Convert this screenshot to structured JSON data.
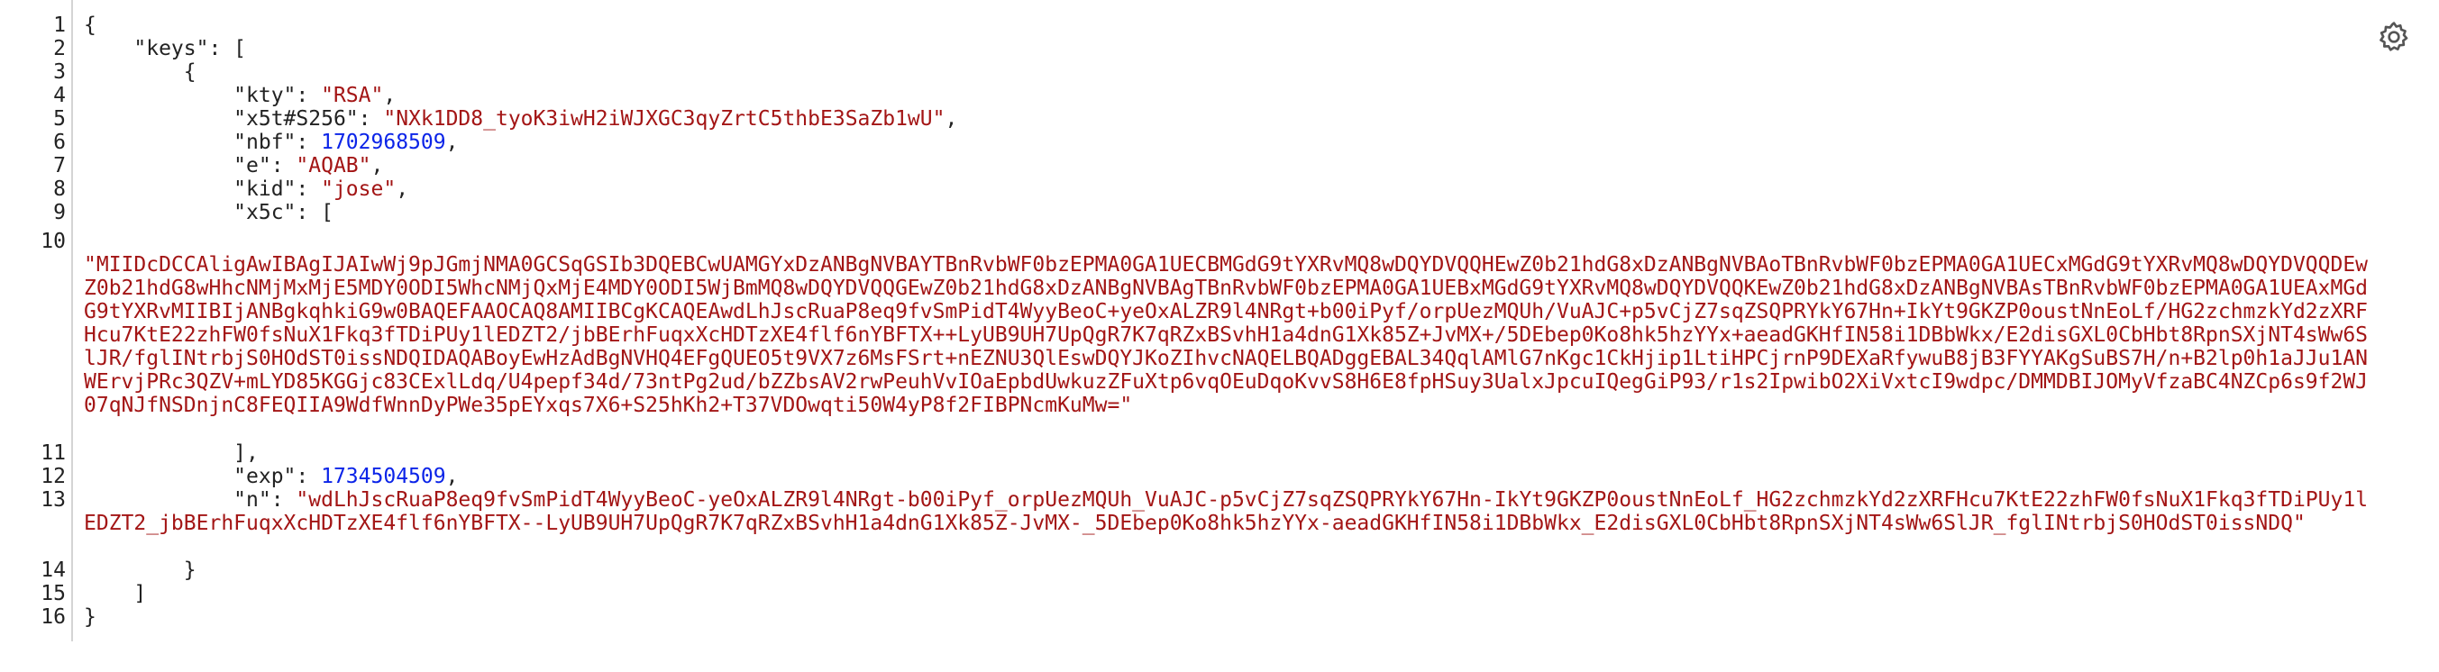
{
  "editor": {
    "line_numbers": [
      "1",
      "2",
      "3",
      "4",
      "5",
      "6",
      "7",
      "8",
      "9",
      "10",
      "11",
      "12",
      "13",
      "14",
      "15",
      "16"
    ],
    "lines": {
      "l1": {
        "p1": "{"
      },
      "l2": {
        "p1": "    \"keys\": ["
      },
      "l3": {
        "p1": "        {"
      },
      "l4": {
        "k": "            \"kty\": ",
        "v": "\"RSA\"",
        "t": ","
      },
      "l5": {
        "k": "            \"x5t#S256\": ",
        "v": "\"NXk1DD8_tyoK3iwH2iWJXGC3qyZrtC5thbE3SaZb1wU\"",
        "t": ","
      },
      "l6": {
        "k": "            \"nbf\": ",
        "v": "1702968509",
        "t": ","
      },
      "l7": {
        "k": "            \"e\": ",
        "v": "\"AQAB\"",
        "t": ","
      },
      "l8": {
        "k": "            \"kid\": ",
        "v": "\"jose\"",
        "t": ","
      },
      "l9": {
        "p1": "            \"x5c\": ["
      },
      "l10": {
        "v": "\"MIIDcDCCAligAwIBAgIJAIwWj9pJGmjNMA0GCSqGSIb3DQEBCwUAMGYxDzANBgNVBAYTBnRvbWF0bzEPMA0GA1UECBMGdG9tYXRvMQ8wDQYDVQQHEwZ0b21hdG8xDzANBgNVBAoTBnRvbWF0bzEPMA0GA1UECxMGdG9tYXRvMQ8wDQYDVQQDEwZ0b21hdG8wHhcNMjMxMjE5MDY0ODI5WhcNMjQxMjE4MDY0ODI5WjBmMQ8wDQYDVQQGEwZ0b21hdG8xDzANBgNVBAgTBnRvbWF0bzEPMA0GA1UEBxMGdG9tYXRvMQ8wDQYDVQQKEwZ0b21hdG8xDzANBgNVBAsTBnRvbWF0bzEPMA0GA1UEAxMGdG9tYXRvMIIBIjANBgkqhkiG9w0BAQEFAAOCAQ8AMIIBCgKCAQEAwdLhJscRuaP8eq9fvSmPidT4WyyBeoC+yeOxALZR9l4NRgt+b00iPyf/orpUezMQUh/VuAJC+p5vCjZ7sqZSQPRYkY67Hn+IkYt9GKZP0oustNnEoLf/HG2zchmzkYd2zXRFHcu7KtE22zhFW0fsNuX1Fkq3fTDiPUy1lEDZT2/jbBErhFuqxXcHDTzXE4flf6nYBFTX++LyUB9UH7UpQgR7K7qRZxBSvhH1a4dnG1Xk85Z+JvMX+/5DEbep0Ko8hk5hzYYx+aeadGKHfIN58i1DBbWkx/E2disGXL0CbHbt8RpnSXjNT4sWw6SlJR/fglINtrbjS0HOdST0issNDQIDAQABoyEwHzAdBgNVHQ4EFgQUEO5t9VX7z6MsFSrt+nEZNU3QlEswDQYJKoZIhvcNAQELBQADggEBAL34QqlAMlG7nKgc1CkHjip1LtiHPCjrnP9DEXaRfywuB8jB3FYYAKgSuBS7H/n+B2lp0h1aJJu1ANWErvjPRc3QZV+mLYD85KGGjc83CExlLdq/U4pepf34d/73ntPg2ud/bZZbsAV2rwPeuhVvIOaEpbdUwkuzZFuXtp6vqOEuDqoKvvS8H6E8fpHSuy3UalxJpcuIQegGiP93/r1s2IpwibO2XiVxtcI9wdpc/DMMDBIJOMyVfzaBC4NZCp6s9f2WJ07qNJfNSDnjnC8FEQIIA9WdfWnnDyPWe35pEYxqs7X6+S25hKh2+T37VDOwqti50W4yP8f2FIBPNcmKuMw=\""
      },
      "l11": {
        "p1": "            ],"
      },
      "l12": {
        "k": "            \"exp\": ",
        "v": "1734504509",
        "t": ","
      },
      "l13": {
        "k": "            \"n\": ",
        "v": "\"wdLhJscRuaP8eq9fvSmPidT4WyyBeoC-yeOxALZR9l4NRgt-b00iPyf_orpUezMQUh_VuAJC-p5vCjZ7sqZSQPRYkY67Hn-IkYt9GKZP0oustNnEoLf_HG2zchmzkYd2zXRFHcu7KtE22zhFW0fsNuX1Fkq3fTDiPUy1lEDZT2_jbBErhFuqxXcHDTzXE4flf6nYBFTX--LyUB9UH7UpQgR7K7qRZxBSvhH1a4dnG1Xk85Z-JvMX-_5DEbep0Ko8hk5hzYYx-aeadGKHfIN58i1DBbWkx_E2disGXL0CbHbt8RpnSXjNT4sWw6SlJR_fglINtrbjS0HOdST0issNDQ\""
      },
      "l14": {
        "p1": "        }"
      },
      "l15": {
        "p1": "    ]"
      },
      "l16": {
        "p1": "}"
      }
    }
  },
  "toolbar": {
    "settings_icon": "gear-icon"
  },
  "colors": {
    "string": "#a31515",
    "number": "#0b24e8",
    "text": "#222222",
    "gutter_border": "#d4d4d4"
  }
}
